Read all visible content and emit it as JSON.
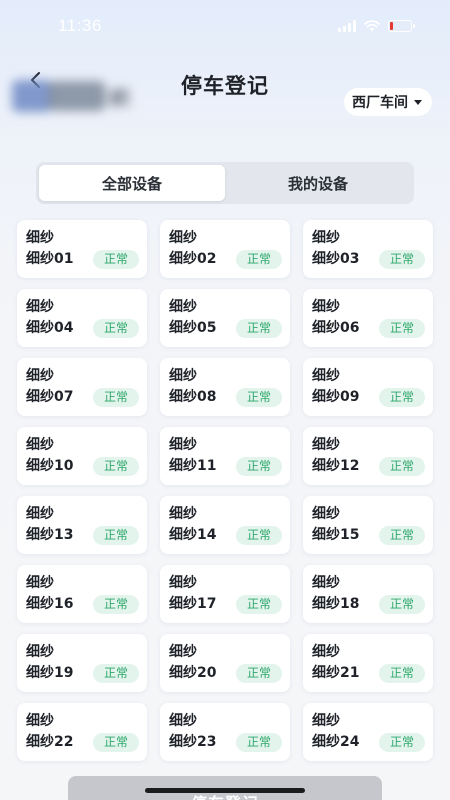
{
  "status_bar": {
    "time": "11:36"
  },
  "header": {
    "title": "停车登记",
    "blurred_org_suffix": "织",
    "workshop_selected": "西厂车间"
  },
  "tabs": [
    {
      "label": "全部设备",
      "active": true
    },
    {
      "label": "我的设备",
      "active": false
    }
  ],
  "devices": [
    {
      "type": "细纱",
      "name": "细纱01",
      "status": "正常"
    },
    {
      "type": "细纱",
      "name": "细纱02",
      "status": "正常"
    },
    {
      "type": "细纱",
      "name": "细纱03",
      "status": "正常"
    },
    {
      "type": "细纱",
      "name": "细纱04",
      "status": "正常"
    },
    {
      "type": "细纱",
      "name": "细纱05",
      "status": "正常"
    },
    {
      "type": "细纱",
      "name": "细纱06",
      "status": "正常"
    },
    {
      "type": "细纱",
      "name": "细纱07",
      "status": "正常"
    },
    {
      "type": "细纱",
      "name": "细纱08",
      "status": "正常"
    },
    {
      "type": "细纱",
      "name": "细纱09",
      "status": "正常"
    },
    {
      "type": "细纱",
      "name": "细纱10",
      "status": "正常"
    },
    {
      "type": "细纱",
      "name": "细纱11",
      "status": "正常"
    },
    {
      "type": "细纱",
      "name": "细纱12",
      "status": "正常"
    },
    {
      "type": "细纱",
      "name": "细纱13",
      "status": "正常"
    },
    {
      "type": "细纱",
      "name": "细纱14",
      "status": "正常"
    },
    {
      "type": "细纱",
      "name": "细纱15",
      "status": "正常"
    },
    {
      "type": "细纱",
      "name": "细纱16",
      "status": "正常"
    },
    {
      "type": "细纱",
      "name": "细纱17",
      "status": "正常"
    },
    {
      "type": "细纱",
      "name": "细纱18",
      "status": "正常"
    },
    {
      "type": "细纱",
      "name": "细纱19",
      "status": "正常"
    },
    {
      "type": "细纱",
      "name": "细纱20",
      "status": "正常"
    },
    {
      "type": "细纱",
      "name": "细纱21",
      "status": "正常"
    },
    {
      "type": "细纱",
      "name": "细纱22",
      "status": "正常"
    },
    {
      "type": "细纱",
      "name": "细纱23",
      "status": "正常"
    },
    {
      "type": "细纱",
      "name": "细纱24",
      "status": "正常"
    }
  ],
  "footer": {
    "submit_label": "停车登记"
  },
  "colors": {
    "status_normal_text": "#2fa86b",
    "status_normal_bg": "#e2f4ec",
    "battery_low": "#e53935"
  },
  "icons": {
    "back": "chevron-left-icon",
    "dropdown": "caret-down-icon",
    "signal": "cellular-signal-icon",
    "wifi": "wifi-icon",
    "battery": "battery-icon"
  }
}
